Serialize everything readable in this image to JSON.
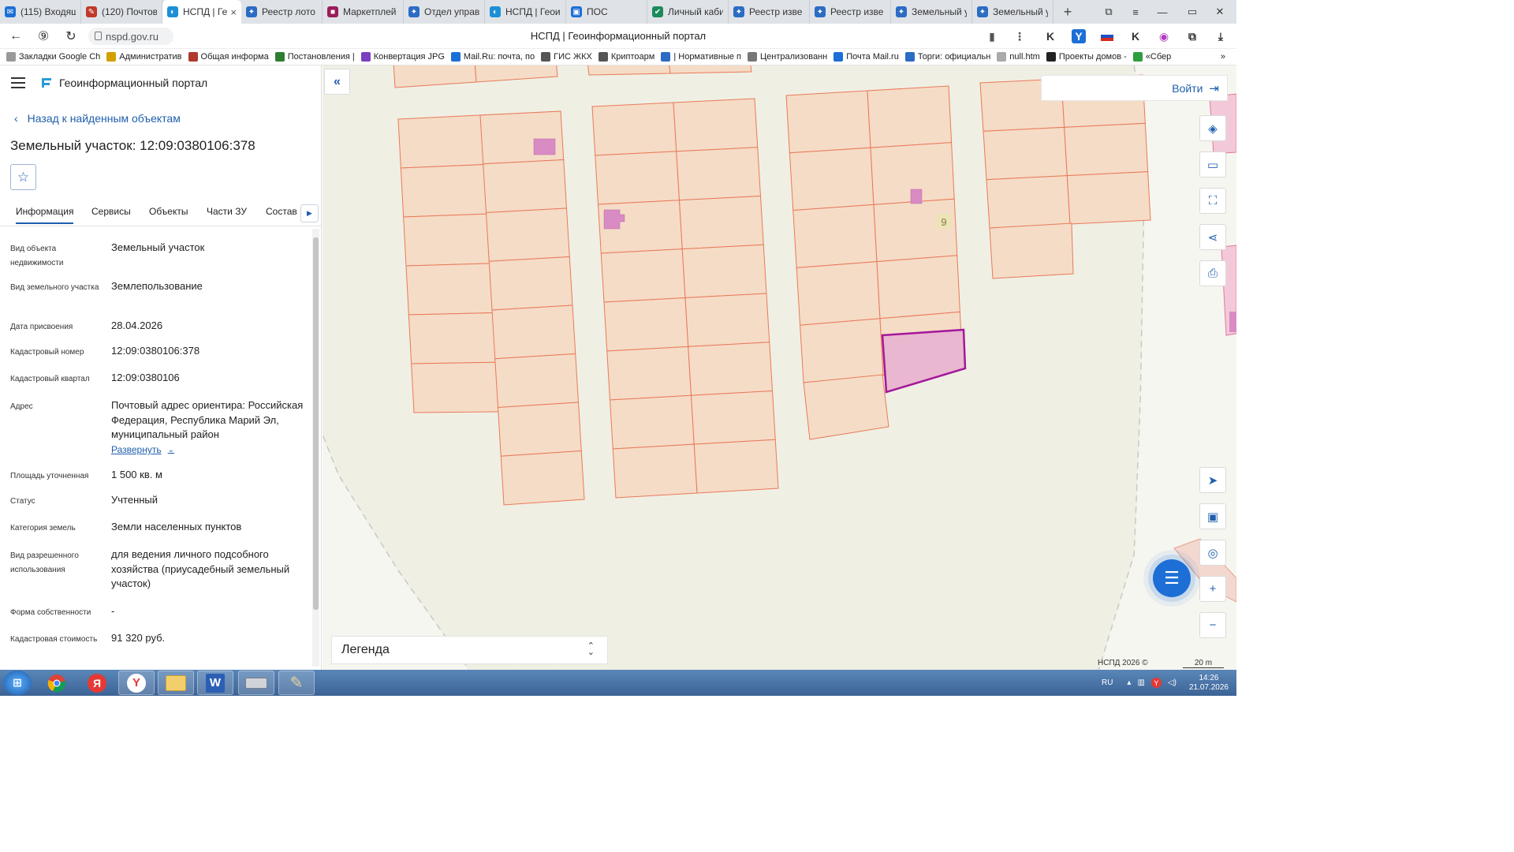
{
  "browser": {
    "tabs": [
      {
        "label": "(115) Входящ",
        "color": "#1d6fd6",
        "glyph": "✉"
      },
      {
        "label": "(120) Почтов",
        "color": "#c0392b",
        "glyph": "✎"
      },
      {
        "label": "НСПД | Ге",
        "color": "#1d8fd6",
        "glyph": "◐",
        "active": true,
        "close": "×"
      },
      {
        "label": "Реестр лото",
        "color": "#2b6cc4",
        "glyph": "✦"
      },
      {
        "label": "Маркетплей",
        "color": "#9b1c5a",
        "glyph": "■"
      },
      {
        "label": "Отдел управ",
        "color": "#2b6cc4",
        "glyph": "✦"
      },
      {
        "label": "НСПД | Геои",
        "color": "#1d8fd6",
        "glyph": "◐"
      },
      {
        "label": "ПОС",
        "color": "#1d6fd6",
        "glyph": "▣"
      },
      {
        "label": "Личный каби",
        "color": "#1b8a5a",
        "glyph": "✔"
      },
      {
        "label": "Реестр изве",
        "color": "#2b6cc4",
        "glyph": "✦"
      },
      {
        "label": "Реестр изве",
        "color": "#2b6cc4",
        "glyph": "✦"
      },
      {
        "label": "Земельный у",
        "color": "#2b6cc4",
        "glyph": "✦"
      },
      {
        "label": "Земельный у",
        "color": "#2b6cc4",
        "glyph": "✦"
      }
    ],
    "new_tab": "+",
    "url": "nspd.gov.ru",
    "page_title": "НСПД | Геоинформационный портал",
    "window_controls": [
      "⧉",
      "≡",
      "—",
      "▭",
      "✕"
    ],
    "bookmarks": [
      {
        "label": "Закладки Google Ch",
        "color": "#999"
      },
      {
        "label": "Административ",
        "color": "#d4a000"
      },
      {
        "label": "Общая информа",
        "color": "#b03a2e"
      },
      {
        "label": "Постановления |",
        "color": "#2e7d32"
      },
      {
        "label": "Конвертация JPG",
        "color": "#7b3fbf"
      },
      {
        "label": "Mail.Ru: почта, по",
        "color": "#1d6fd6"
      },
      {
        "label": "ГИС ЖКХ",
        "color": "#555"
      },
      {
        "label": "Криптоарм",
        "color": "#555"
      },
      {
        "label": "| Нормативные п",
        "color": "#2b6cc4"
      },
      {
        "label": "Централизованн",
        "color": "#777"
      },
      {
        "label": "Почта Mail.ru",
        "color": "#1d6fd6"
      },
      {
        "label": "Торги: официальн",
        "color": "#2b6cc4"
      },
      {
        "label": "null.htm",
        "color": "#aaa"
      },
      {
        "label": "Проекты домов -",
        "color": "#222"
      },
      {
        "label": "«Сбер",
        "color": "#2e9e3e"
      }
    ],
    "bookmarks_more": "»"
  },
  "panel": {
    "portal_name": "Геоинформационный портал",
    "back_link": "Назад к найденным объектам",
    "object_title": "Земельный участок: 12:09:0380106:378",
    "tabs": [
      "Информация",
      "Сервисы",
      "Объекты",
      "Части ЗУ",
      "Состав"
    ],
    "properties": [
      {
        "label": "Вид объекта недвижимости",
        "value": "Земельный участок"
      },
      {
        "label": "Вид земельного участка",
        "value": "Землепользование"
      },
      {
        "label": "Дата присвоения",
        "value": "28.04.2026"
      },
      {
        "label": "Кадастровый номер",
        "value": "12:09:0380106:378"
      },
      {
        "label": "Кадастровый квартал",
        "value": "12:09:0380106"
      },
      {
        "label": "Адрес",
        "value": "Почтовый адрес ориентира: Российская Федерация, Республика Марий Эл, муниципальный район"
      },
      {
        "label": "Площадь уточненная",
        "value": "1 500 кв. м"
      },
      {
        "label": "Статус",
        "value": "Учтенный"
      },
      {
        "label": "Категория земель",
        "value": "Земли населенных пунктов"
      },
      {
        "label": "Вид разрешенного использования",
        "value": "для ведения личного подсобного хозяйства (приусадебный земельный участок)"
      },
      {
        "label": "Форма собственности",
        "value": "-"
      },
      {
        "label": "Кадастровая стоимость",
        "value": "91 320 руб."
      }
    ],
    "expand_link": "Развернуть"
  },
  "map": {
    "login_label": "Войти",
    "legend_label": "Легенда",
    "parcel_number_label": "9",
    "copyright": "НСПД 2026 ©",
    "scale_label": "20 m",
    "colors": {
      "background": "#f0efe4",
      "parcel_fill": "#f5dcc6",
      "parcel_stroke": "#e87a5a",
      "building_fill": "#d98bc4",
      "selected_fill": "#e9b7cf",
      "selected_stroke": "#a3179b",
      "accent": "#1f5fad"
    }
  },
  "taskbar": {
    "apps": [
      "Chrome",
      "Яндекс",
      "Y",
      "Проводник",
      "W",
      "Сканер",
      "Paint"
    ],
    "language": "RU",
    "time": "14:26",
    "date": "21.07.2026"
  }
}
